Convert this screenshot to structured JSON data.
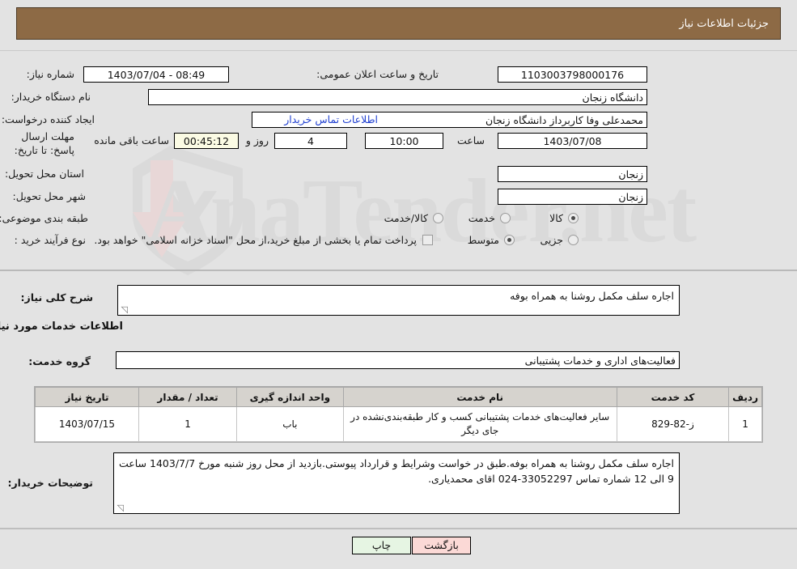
{
  "header": {
    "title": "جزئیات اطلاعات نیاز"
  },
  "watermark": {
    "text": "AnaTender.net"
  },
  "form": {
    "need_number_label": "شماره نیاز:",
    "need_number_value": "1103003798000176",
    "announce_datetime_label": "تاریخ و ساعت اعلان عمومی:",
    "announce_datetime_value": "08:49 - 1403/07/04",
    "buyer_org_label": "نام دستگاه خریدار:",
    "buyer_org_value": "دانشگاه زنجان",
    "creator_label": "ایجاد کننده درخواست:",
    "creator_value": "محمدعلی وفا کاربرداز دانشگاه زنجان",
    "buyer_contact_link": "اطلاعات تماس خریدار",
    "deadline_label": "مهلت ارسال پاسخ: تا تاریخ:",
    "deadline_date_value": "1403/07/08",
    "deadline_hour_label": "ساعت",
    "deadline_hour_value": "10:00",
    "remaining_days_value": "4",
    "remaining_days_label": "روز و",
    "remaining_time_value": "00:45:12",
    "remaining_time_label": "ساعت باقی مانده",
    "province_label": "استان محل تحویل:",
    "province_value": "زنجان",
    "city_label": "شهر محل تحویل:",
    "city_value": "زنجان",
    "category_label": "طبقه بندی موضوعی:",
    "category_options": [
      {
        "label": "کالا",
        "selected": true
      },
      {
        "label": "خدمت",
        "selected": false
      },
      {
        "label": "کالا/خدمت",
        "selected": false
      }
    ],
    "process_label": "نوع فرآیند خرید :",
    "process_options": [
      {
        "label": "جزیی",
        "selected": false
      },
      {
        "label": "متوسط",
        "selected": true
      }
    ],
    "treasury_checkbox_label": "پرداخت تمام یا بخشی از مبلغ خرید،از محل \"اسناد خزانه اسلامی\" خواهد بود.",
    "treasury_checked": false
  },
  "description": {
    "general_label": "شرح کلی نیاز:",
    "general_value": "اجاره سلف مکمل روشنا به همراه بوفه",
    "services_section_title": "اطلاعات خدمات مورد نیاز",
    "service_group_label": "گروه خدمت:",
    "service_group_value": "فعالیت‌های اداری و خدمات پشتیبانی"
  },
  "table": {
    "columns": [
      "ردیف",
      "کد خدمت",
      "نام خدمت",
      "واحد اندازه گیری",
      "تعداد / مقدار",
      "تاریخ نیاز"
    ],
    "rows": [
      {
        "row_no": "1",
        "service_code": "ز-82-829",
        "service_name": "سایر فعالیت‌های خدمات پشتیبانی کسب و کار طبقه‌بندی‌نشده در جای دیگر",
        "unit": "باب",
        "quantity": "1",
        "need_date": "1403/07/15"
      }
    ]
  },
  "buyer_notes": {
    "label": "توضیحات خریدار:",
    "value": "اجاره سلف مکمل روشنا به همراه بوفه.طبق در خواست وشرایط و قرارداد پیوستی.بازدید از محل روز شنبه مورخ 1403/7/7 ساعت 9 الی 12 شماره تماس 33052297-024 اقای محمدیاری."
  },
  "footer": {
    "print_button": "چاپ",
    "back_button": "بازگشت"
  },
  "colors": {
    "header_bg": "#8d6a45",
    "link": "#1f3fd0",
    "print_bg": "#e6f5e3",
    "back_bg": "#fbd9d6",
    "page_bg": "#e3e3e3",
    "table_header_bg": "#d6d3ce"
  }
}
